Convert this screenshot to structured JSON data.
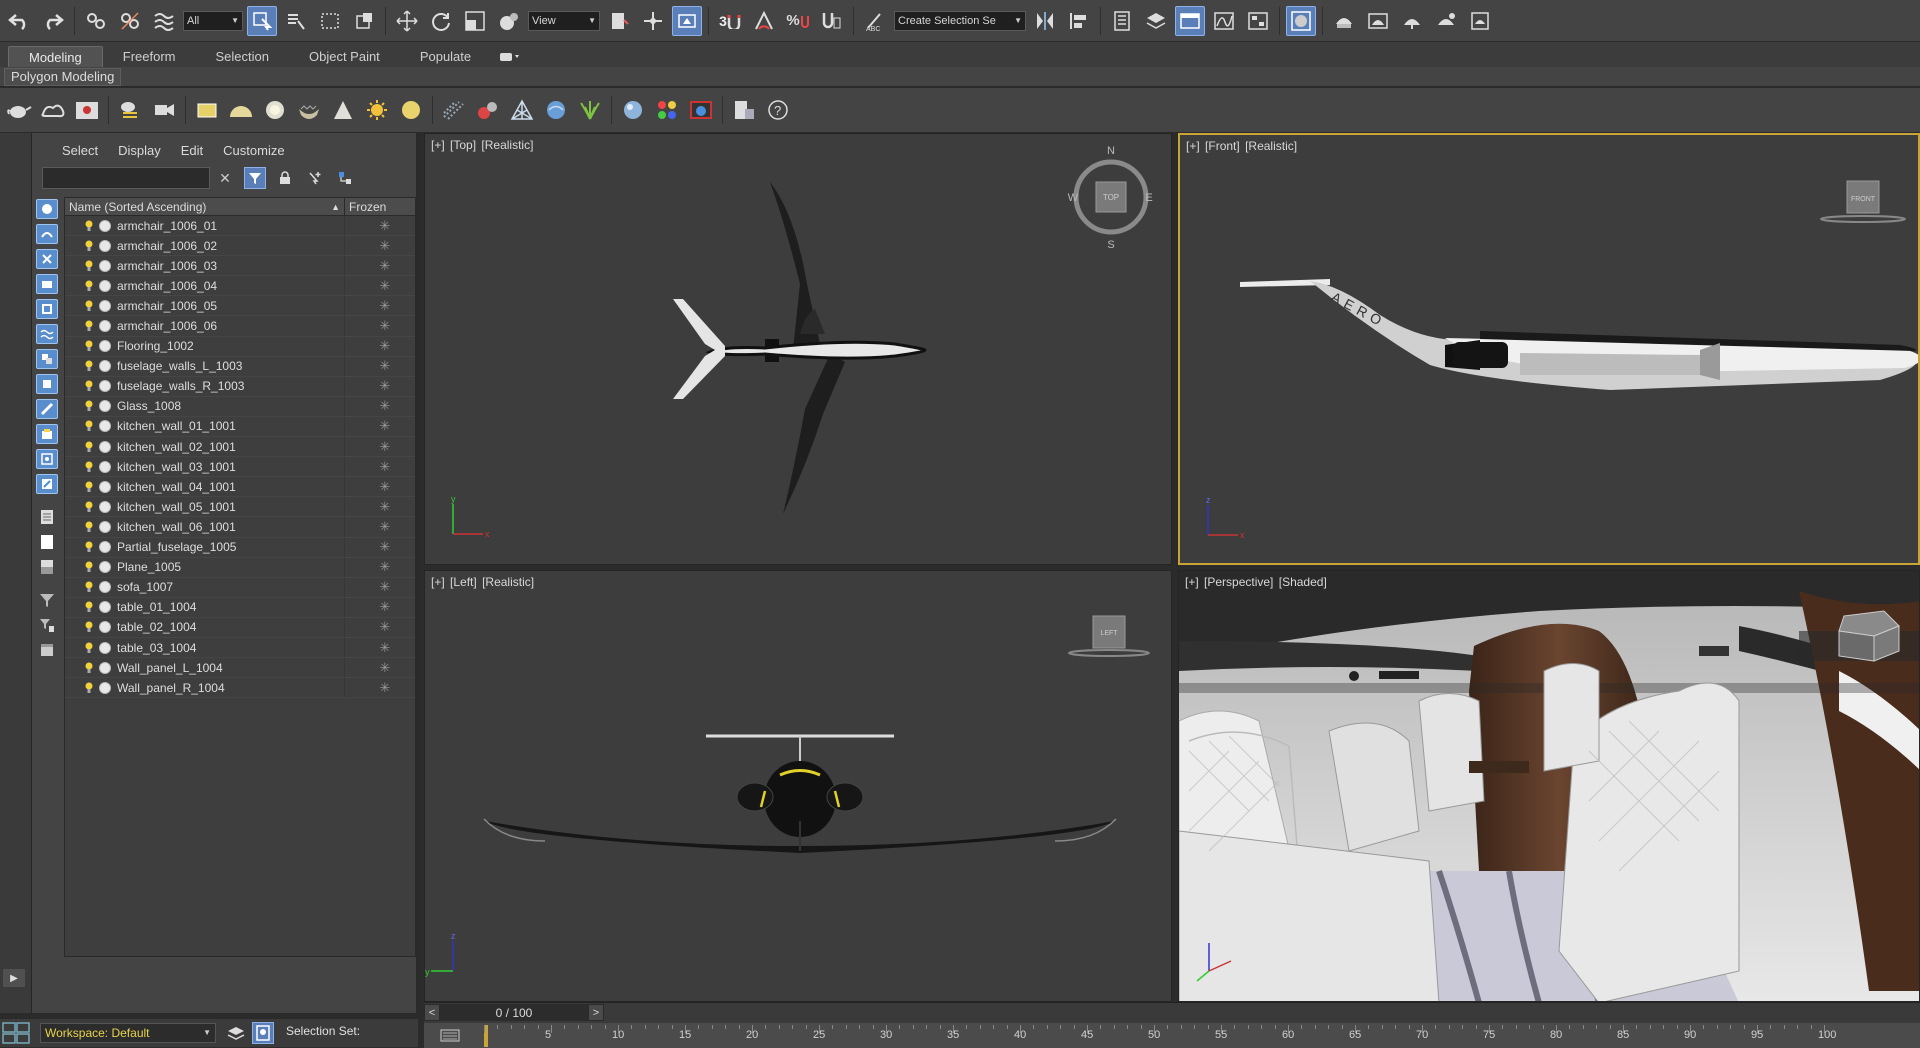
{
  "toolbar": {
    "filter_dropdown": "All",
    "ref_coord_dropdown": "View",
    "snap_label": "3",
    "create_selection_set": "Create Selection Se"
  },
  "ribbon": {
    "tabs": [
      "Modeling",
      "Freeform",
      "Selection",
      "Object Paint",
      "Populate"
    ],
    "active_tab": "Modeling",
    "sub_label": "Polygon Modeling"
  },
  "scene_explorer": {
    "menu": [
      "Select",
      "Display",
      "Edit",
      "Customize"
    ],
    "column_name": "Name (Sorted Ascending)",
    "column_frozen": "Frozen",
    "items": [
      "armchair_1006_01",
      "armchair_1006_02",
      "armchair_1006_03",
      "armchair_1006_04",
      "armchair_1006_05",
      "armchair_1006_06",
      "Flooring_1002",
      "fuselage_walls_L_1003",
      "fuselage_walls_R_1003",
      "Glass_1008",
      "kitchen_wall_01_1001",
      "kitchen_wall_02_1001",
      "kitchen_wall_03_1001",
      "kitchen_wall_04_1001",
      "kitchen_wall_05_1001",
      "kitchen_wall_06_1001",
      "Partial_fuselage_1005",
      "Plane_1005",
      "sofa_1007",
      "table_01_1004",
      "table_02_1004",
      "table_03_1004",
      "Wall_panel_L_1004",
      "Wall_panel_R_1004"
    ]
  },
  "viewports": {
    "top": {
      "plus": "[+]",
      "view": "[Top]",
      "shading": "[Realistic]",
      "compass": {
        "n": "N",
        "s": "S",
        "e": "E",
        "w": "W",
        "cube": "TOP"
      }
    },
    "front": {
      "plus": "[+]",
      "view": "[Front]",
      "shading": "[Realistic]",
      "cube": "FRONT",
      "livery": "AERO"
    },
    "left": {
      "plus": "[+]",
      "view": "[Left]",
      "shading": "[Realistic]",
      "cube": "LEFT"
    },
    "perspective": {
      "plus": "[+]",
      "view": "[Perspective]",
      "shading": "[Shaded]"
    }
  },
  "status": {
    "workspace": "Workspace: Default",
    "selection_set": "Selection Set:"
  },
  "timeline": {
    "frame": "0 / 100",
    "prev": "<",
    "next": ">",
    "ticks": [
      "5",
      "10",
      "15",
      "20",
      "25",
      "30",
      "35",
      "40",
      "45",
      "50",
      "55",
      "60",
      "65",
      "70",
      "75",
      "80",
      "85",
      "90",
      "95",
      "100"
    ]
  },
  "colors": {
    "accent_blue": "#5a7fb8",
    "active_border": "#c9a437",
    "workspace_text": "#e8d34a"
  }
}
